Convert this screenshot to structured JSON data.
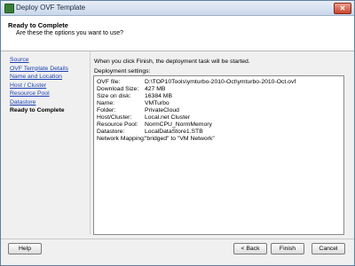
{
  "window": {
    "title": "Deploy OVF Template",
    "close_label": "✕"
  },
  "header": {
    "title": "Ready to Complete",
    "subtitle": "Are these the options you want to use?"
  },
  "nav": {
    "items": [
      {
        "label": "Source"
      },
      {
        "label": "OVF Template Details"
      },
      {
        "label": "Name and Location"
      },
      {
        "label": "Host / Cluster"
      },
      {
        "label": "Resource Pool"
      },
      {
        "label": "Datastore"
      },
      {
        "label": "Ready to Complete"
      }
    ]
  },
  "main": {
    "intro": "When you click Finish, the deployment task will be started.",
    "settings_label": "Deployment settings:",
    "settings": [
      {
        "key": "OVF file:",
        "value": "D:\\TOP10Tools\\ymturbo-2010-Oct\\ymturbo-2010-Oct.ovf"
      },
      {
        "key": "Download Size:",
        "value": "427 MB"
      },
      {
        "key": "Size on disk:",
        "value": "16384 MB"
      },
      {
        "key": "Name:",
        "value": "VMTurbo"
      },
      {
        "key": "Folder:",
        "value": "PrivateCloud"
      },
      {
        "key": "Host/Cluster:",
        "value": "Local.net Cluster"
      },
      {
        "key": "Resource Pool:",
        "value": "NormCPU_NormMemory"
      },
      {
        "key": "Datastore:",
        "value": "LocalDataStore1.STB"
      },
      {
        "key": "Network Mapping:",
        "value": "\"bridged\" to \"VM Network\""
      }
    ]
  },
  "footer": {
    "help": "Help",
    "back": "< Back",
    "finish": "Finish",
    "cancel": "Cancel"
  }
}
